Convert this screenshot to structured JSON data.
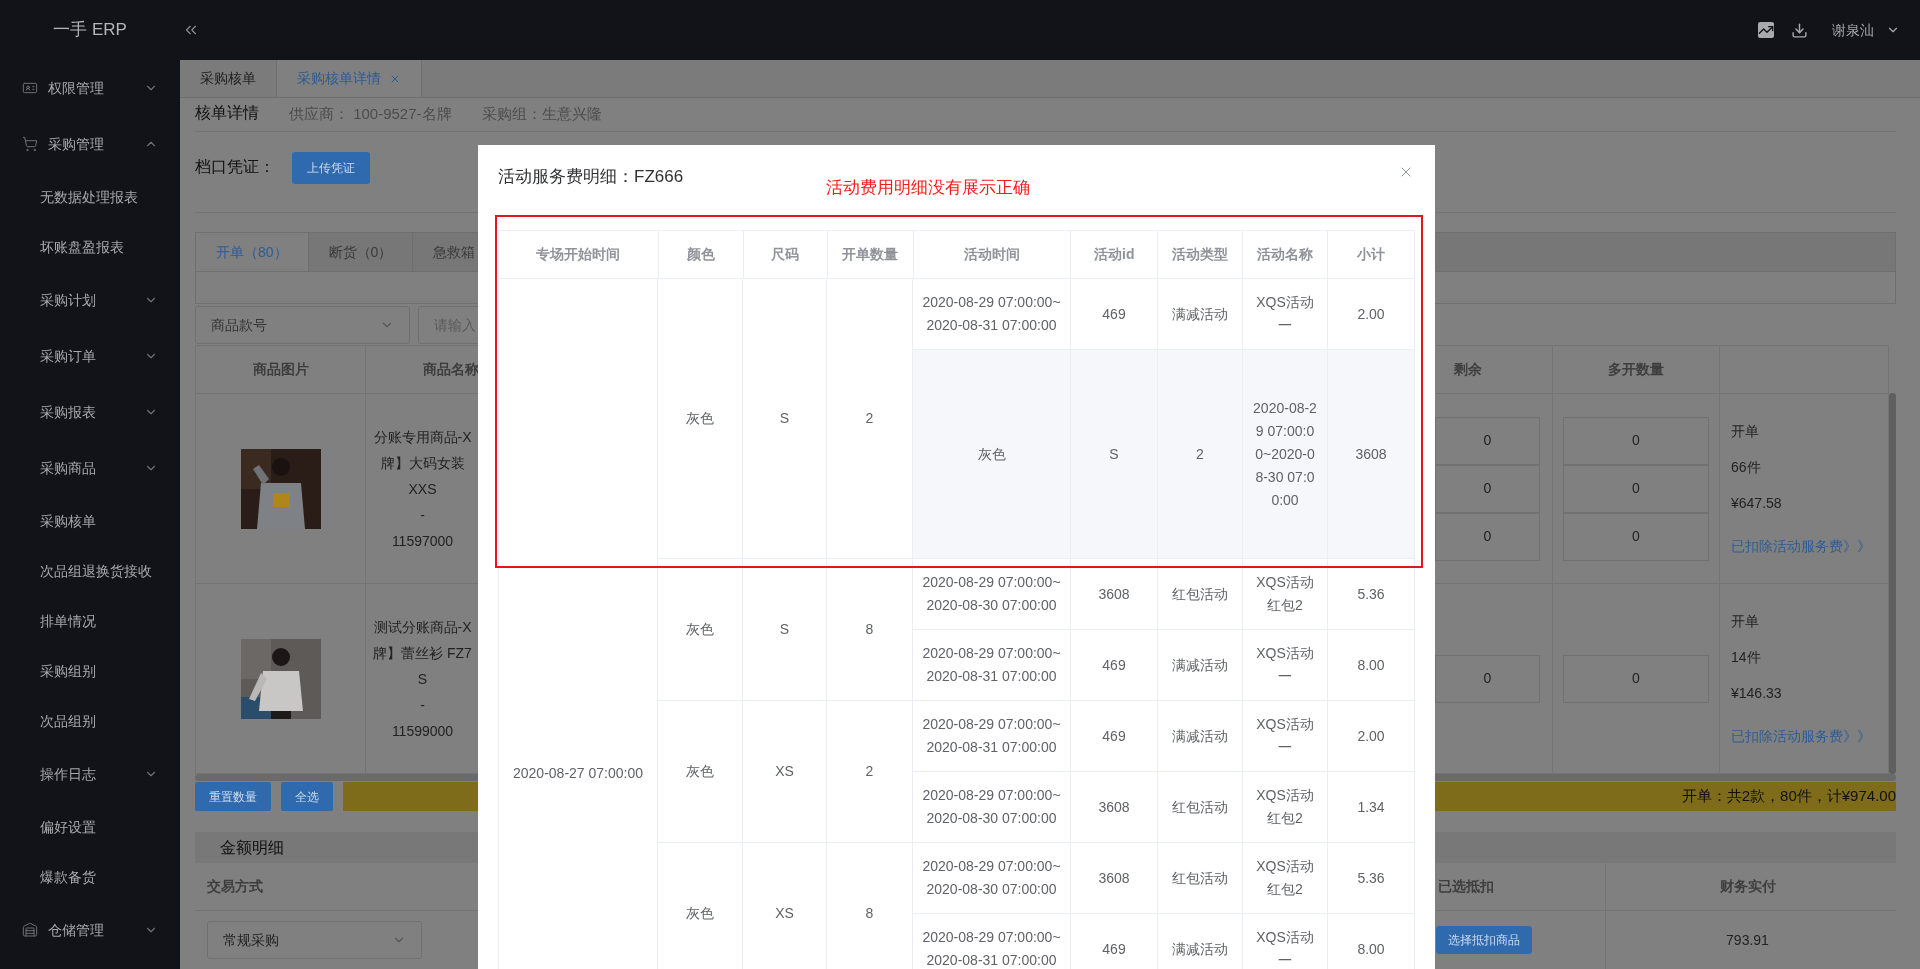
{
  "app": {
    "logo": "一手 ERP"
  },
  "header": {
    "user": "谢泉汕"
  },
  "sidebar": {
    "items": [
      {
        "label": "权限管理",
        "kind": "group",
        "expanded": false
      },
      {
        "label": "采购管理",
        "kind": "group",
        "expanded": true,
        "children": [
          {
            "label": "无数据处理报表",
            "kind": "link"
          },
          {
            "label": "坏账盘盈报表",
            "kind": "link"
          },
          {
            "label": "采购计划",
            "kind": "group",
            "expanded": false
          },
          {
            "label": "采购订单",
            "kind": "group",
            "expanded": false
          },
          {
            "label": "采购报表",
            "kind": "group",
            "expanded": false
          },
          {
            "label": "采购商品",
            "kind": "group",
            "expanded": false
          },
          {
            "label": "采购核单",
            "kind": "link"
          },
          {
            "label": "次品组退换货接收",
            "kind": "link"
          },
          {
            "label": "排单情况",
            "kind": "link"
          },
          {
            "label": "采购组别",
            "kind": "link"
          },
          {
            "label": "次品组别",
            "kind": "link"
          },
          {
            "label": "操作日志",
            "kind": "group",
            "expanded": false
          },
          {
            "label": "偏好设置",
            "kind": "link"
          },
          {
            "label": "爆款备货",
            "kind": "link"
          }
        ]
      },
      {
        "label": "仓储管理",
        "kind": "group",
        "expanded": false
      }
    ]
  },
  "page_tabs": [
    {
      "label": "采购核单",
      "selected": false,
      "closable": false
    },
    {
      "label": "采购核单详情",
      "selected": true,
      "closable": true
    }
  ],
  "detail_header": {
    "title": "核单详情",
    "supplier": "供应商： 100-9527-名牌",
    "group": "采购组：生意兴隆"
  },
  "voucher": {
    "label": "档口凭证：",
    "button": "上传凭证"
  },
  "order_tabs": [
    {
      "label": "开单（80）",
      "selected": true
    },
    {
      "label": "断货（0）",
      "selected": false
    },
    {
      "label": "急救箱",
      "selected": false
    }
  ],
  "filter": {
    "field": "商品款号",
    "search_placeholder": "请输入"
  },
  "goods_table": {
    "columns_left": [
      "商品图片",
      "商品名称"
    ],
    "columns_right": [
      "剩余",
      "多开数量"
    ],
    "rows": [
      {
        "name_lines": [
          "分账专用商品-X",
          "牌】大码女装",
          "XXS",
          "-",
          "11597000"
        ],
        "remaining": [
          "0",
          "0",
          "0"
        ],
        "extra": [
          "0",
          "0",
          "0"
        ],
        "summary": [
          "开单",
          "66件",
          "¥647.58"
        ],
        "link": "已扣除活动服务费》》"
      },
      {
        "name_lines": [
          "测试分账商品-X",
          "牌】蕾丝衫 FZ7",
          "S",
          "-",
          "11599000"
        ],
        "remaining": [
          "0"
        ],
        "extra": [
          "0"
        ],
        "summary": [
          "开单",
          "14件",
          "¥146.33"
        ],
        "link": "已扣除活动服务费》》"
      }
    ]
  },
  "actions": {
    "buttons": [
      "重置数量",
      "全选"
    ],
    "total": "开单：共2款，80件，计¥974.00"
  },
  "amount": {
    "title": "金额明细",
    "columns": [
      "交易方式",
      "已选抵扣",
      "财务实付"
    ],
    "row": {
      "method": "常规采购",
      "deduct_button": "选择抵扣商品",
      "paid": "793.91"
    }
  },
  "modal": {
    "title": "活动服务费明细：FZ666",
    "annotation": "活动费用明细没有展示正确",
    "table": {
      "columns": [
        "专场开始时间",
        "颜色",
        "尺码",
        "开单数量",
        "活动时间",
        "活动id",
        "活动类型",
        "活动名称",
        "小计"
      ],
      "session_start": "2020-08-27 07:00:00",
      "groups": [
        {
          "color_name": "灰色",
          "size": "S",
          "quantity": "2",
          "rows": [
            {
              "kind": "activity",
              "time": [
                "2020-08-29 07:00:00~",
                "2020-08-31 07:00:00"
              ],
              "id": "469",
              "type": "满减活动",
              "name": "XQS活动一",
              "subtotal": "2.00"
            },
            {
              "kind": "misplaced",
              "cells": [
                "灰色",
                "S",
                "2",
                "2020-08-29 07:00:00~2020-08-30 07:00:00",
                "3608"
              ]
            }
          ]
        },
        {
          "color_name": "灰色",
          "size": "S",
          "quantity": "8",
          "rows": [
            {
              "kind": "activity",
              "time": [
                "2020-08-29 07:00:00~",
                "2020-08-30 07:00:00"
              ],
              "id": "3608",
              "type": "红包活动",
              "name": "XQS活动红包2",
              "subtotal": "5.36"
            },
            {
              "kind": "activity",
              "time": [
                "2020-08-29 07:00:00~",
                "2020-08-31 07:00:00"
              ],
              "id": "469",
              "type": "满减活动",
              "name": "XQS活动一",
              "subtotal": "8.00"
            }
          ]
        },
        {
          "color_name": "灰色",
          "size": "XS",
          "quantity": "2",
          "rows": [
            {
              "kind": "activity",
              "time": [
                "2020-08-29 07:00:00~",
                "2020-08-31 07:00:00"
              ],
              "id": "469",
              "type": "满减活动",
              "name": "XQS活动一",
              "subtotal": "2.00"
            },
            {
              "kind": "activity",
              "time": [
                "2020-08-29 07:00:00~",
                "2020-08-30 07:00:00"
              ],
              "id": "3608",
              "type": "红包活动",
              "name": "XQS活动红包2",
              "subtotal": "1.34"
            }
          ]
        },
        {
          "color_name": "灰色",
          "size": "XS",
          "quantity": "8",
          "rows": [
            {
              "kind": "activity",
              "time": [
                "2020-08-29 07:00:00~",
                "2020-08-30 07:00:00"
              ],
              "id": "3608",
              "type": "红包活动",
              "name": "XQS活动红包2",
              "subtotal": "5.36"
            },
            {
              "kind": "activity",
              "time": [
                "2020-08-29 07:00:00~",
                "2020-08-31 07:00:00"
              ],
              "id": "469",
              "type": "满减活动",
              "name": "XQS活动一",
              "subtotal": "8.00"
            }
          ]
        }
      ]
    }
  }
}
